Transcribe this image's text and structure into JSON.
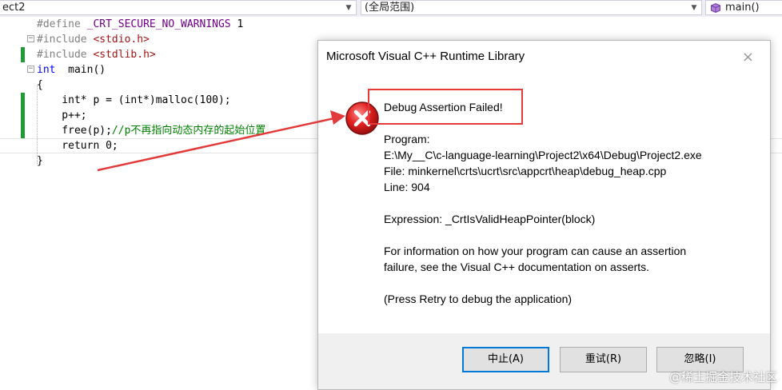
{
  "navbar": {
    "project": "ect2",
    "scope": "(全局范围)",
    "function": "main()"
  },
  "code_lines": [
    {
      "pre": "#define ",
      "macro": "_CRT_SECURE_NO_WARNINGS",
      "rest": " 1"
    },
    {
      "pre": "#include ",
      "str": "<stdio.h>"
    },
    {
      "pre": "#include ",
      "str": "<stdlib.h>"
    },
    {
      "kw": "int",
      "rest": "  main()"
    },
    {
      "rest": "{"
    },
    {
      "rest": "    int* p = (int*)malloc(100);"
    },
    {
      "rest": "    p++;"
    },
    {
      "rest": "    free(p);",
      "cmt": "//p不再指向动态内存的起始位置"
    },
    {
      "rest": "    return 0;"
    },
    {
      "rest": "}"
    }
  ],
  "dialog": {
    "title": "Microsoft Visual C++ Runtime Library",
    "close_glyph": "×",
    "heading": "Debug Assertion Failed!",
    "program_label": "Program:",
    "program_path": "E:\\My__C\\c-language-learning\\Project2\\x64\\Debug\\Project2.exe",
    "file": "File: minkernel\\crts\\ucrt\\src\\appcrt\\heap\\debug_heap.cpp",
    "line": "Line: 904",
    "expression": "Expression: _CrtIsValidHeapPointer(block)",
    "info_1": "For information on how your program can cause an assertion",
    "info_2": "failure, see the Visual C++ documentation on asserts.",
    "retry_hint": "(Press Retry to debug the application)",
    "buttons": {
      "abort": "中止(A)",
      "retry": "重试(R)",
      "ignore": "忽略(I)"
    }
  },
  "watermark": "@稀土掘金技术社区",
  "colors": {
    "highlight_box": "#e23a3a",
    "arrow": "#e23a3a",
    "change_bar": "#1f9c36"
  }
}
